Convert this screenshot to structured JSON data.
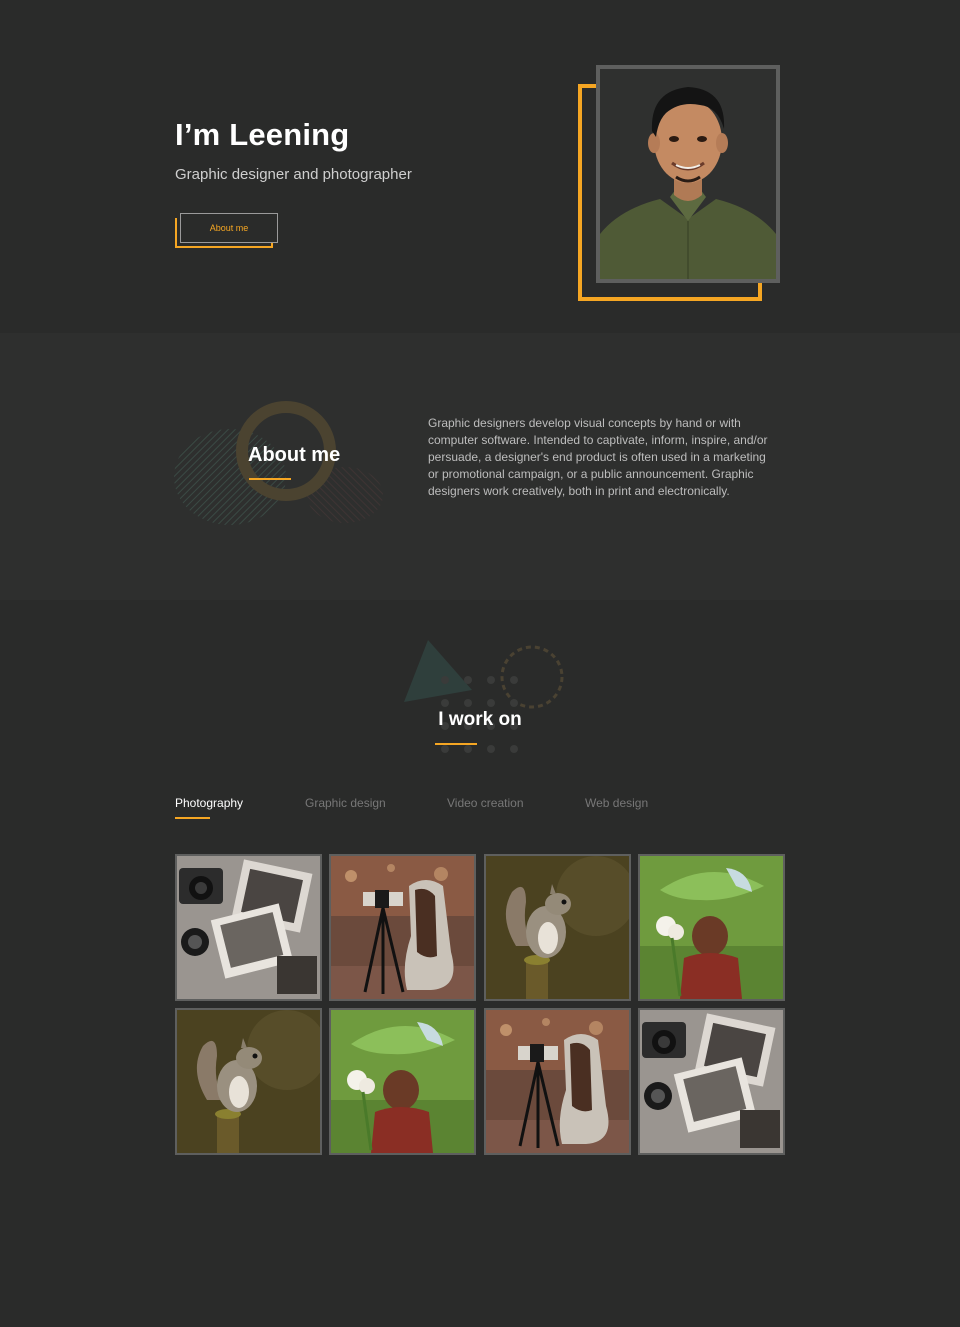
{
  "hero": {
    "title": "I’m Leening",
    "subtitle": "Graphic designer and photographer",
    "button_label": "About me"
  },
  "about": {
    "title": "About me",
    "text": "Graphic designers develop visual concepts by hand or with computer software. Intended to captivate, inform, inspire, and/or persuade, a designer's end product is often used in a marketing or promotional campaign, or a public announcement. Graphic designers work creatively, both in print and electronically."
  },
  "work": {
    "title": "I work on",
    "tabs": [
      "Photography",
      "Graphic design",
      "Video creation",
      "Web design"
    ],
    "active_tab": "Photography",
    "gallery": [
      "camera-photos",
      "girl-camera",
      "squirrel",
      "boy-leaf",
      "squirrel",
      "boy-leaf",
      "girl-camera",
      "camera-photos"
    ]
  },
  "colors": {
    "accent": "#f5a623",
    "background": "#2a2b2a",
    "section_alt": "#2e2f2e",
    "frame_gray": "#5e5f5e"
  }
}
